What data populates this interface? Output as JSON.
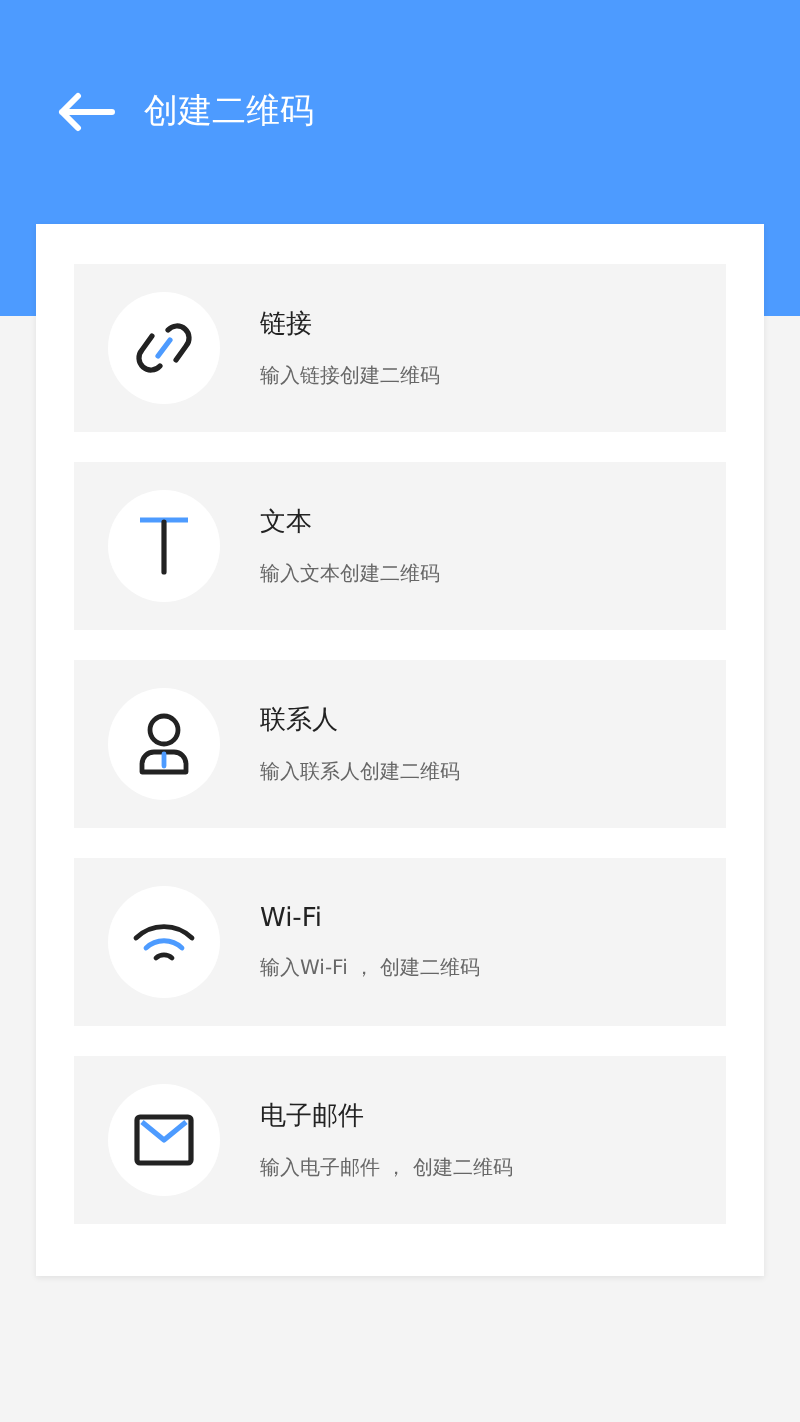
{
  "header": {
    "title": "创建二维码"
  },
  "items": [
    {
      "kind": "link",
      "title": "链接",
      "subtitle": "输入链接创建二维码"
    },
    {
      "kind": "text",
      "title": "文本",
      "subtitle": "输入文本创建二维码"
    },
    {
      "kind": "contact",
      "title": "联系人",
      "subtitle": "输入联系人创建二维码"
    },
    {
      "kind": "wifi",
      "title": "Wi-Fi",
      "subtitle": "输入Wi-Fi ， 创建二维码"
    },
    {
      "kind": "email",
      "title": "电子邮件",
      "subtitle": "输入电子邮件 ， 创建二维码"
    }
  ]
}
